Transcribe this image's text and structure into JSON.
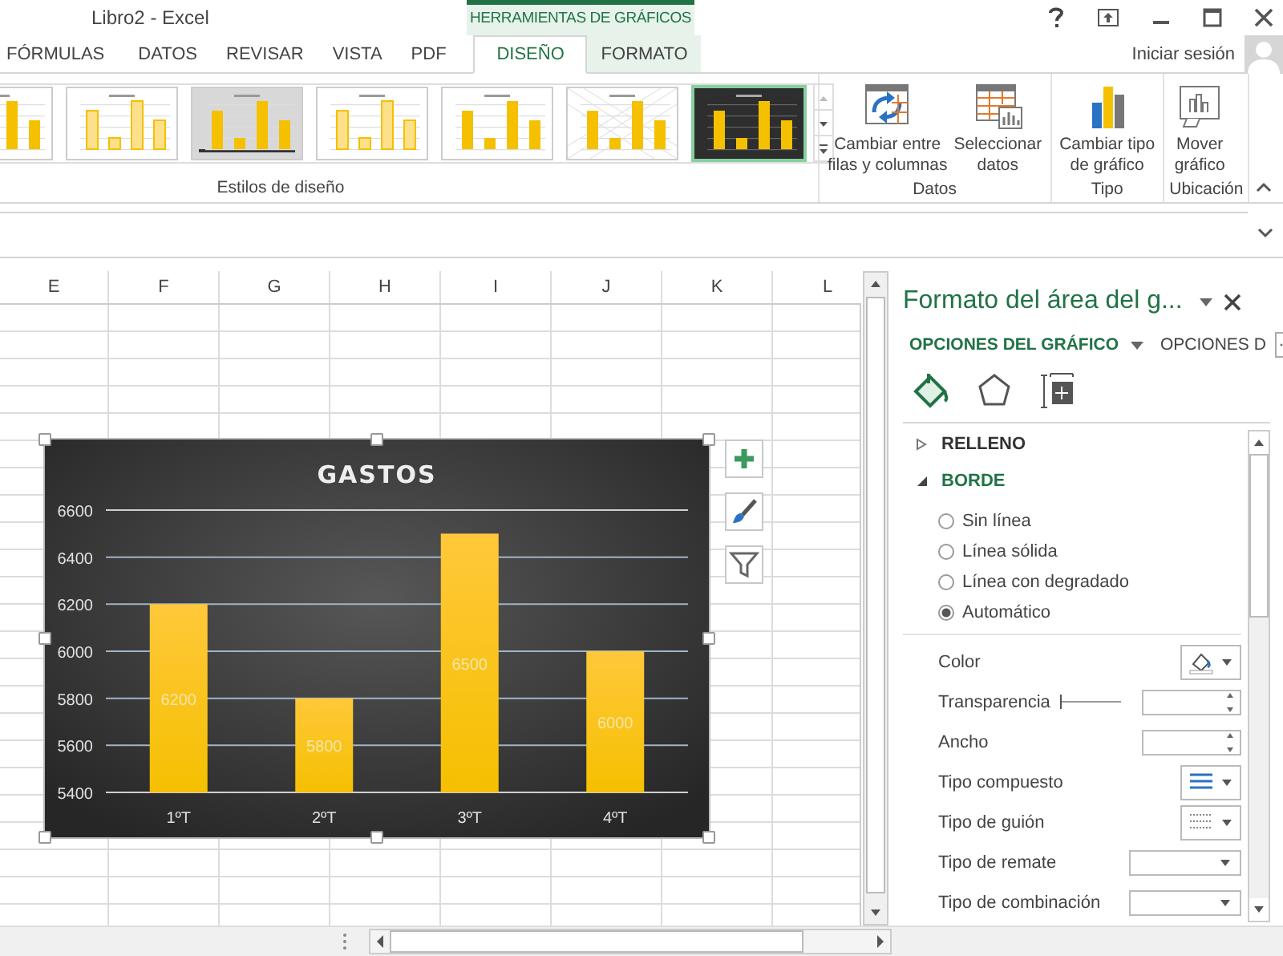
{
  "window": {
    "title": "Libro2 - Excel",
    "context_header": "HERRAMIENTAS DE GRÁFICOS"
  },
  "tabs": [
    {
      "label": "FÓRMULAS",
      "selected": false,
      "contextual": false
    },
    {
      "label": "DATOS",
      "selected": false,
      "contextual": false
    },
    {
      "label": "REVISAR",
      "selected": false,
      "contextual": false
    },
    {
      "label": "VISTA",
      "selected": false,
      "contextual": false
    },
    {
      "label": "PDF",
      "selected": false,
      "contextual": false
    },
    {
      "label": "DISEÑO",
      "selected": true,
      "contextual": true
    },
    {
      "label": "FORMATO",
      "selected": false,
      "contextual": true
    }
  ],
  "account": {
    "label": "Iniciar sesión"
  },
  "ribbon": {
    "chart_styles": [
      {
        "kind": "white",
        "selected": false
      },
      {
        "kind": "striped",
        "selected": false
      },
      {
        "kind": "gray",
        "selected": false
      },
      {
        "kind": "outline",
        "selected": false
      },
      {
        "kind": "plain",
        "selected": false
      },
      {
        "kind": "hatched",
        "selected": false
      },
      {
        "kind": "dark",
        "selected": true
      }
    ],
    "styles_group_label": "Estilos de diseño",
    "groups": [
      {
        "label": "Datos",
        "buttons": [
          {
            "kind": "switch",
            "label": "Cambiar entre\nfilas y columnas"
          },
          {
            "kind": "select",
            "label": "Seleccionar\ndatos"
          }
        ]
      },
      {
        "label": "Tipo",
        "buttons": [
          {
            "kind": "type",
            "label": "Cambiar tipo\nde gráfico"
          }
        ]
      },
      {
        "label": "Ubicación",
        "buttons": [
          {
            "kind": "move",
            "label": "Mover\ngráfico"
          }
        ]
      }
    ]
  },
  "sheet": {
    "columns": [
      "E",
      "F",
      "G",
      "H",
      "I",
      "J",
      "K",
      "L"
    ]
  },
  "chart": {
    "chart_data": {
      "type": "bar",
      "title": "GASTOS",
      "categories": [
        "1ºT",
        "2ºT",
        "3ºT",
        "4ºT"
      ],
      "series": [
        {
          "color": "#f5c000",
          "values": [
            6200,
            5800,
            6500,
            6000
          ]
        }
      ],
      "grid": true,
      "ylim": [
        5400,
        6600
      ],
      "yticks": [
        5400,
        5600,
        5800,
        6000,
        6200,
        6400,
        6600
      ],
      "data_labels": true
    }
  },
  "pane": {
    "title": "Formato del área del g...",
    "tabs": [
      {
        "label": "OPCIONES DEL GRÁFICO",
        "selected": true
      },
      {
        "label": "OPCIONES D",
        "selected": false
      }
    ],
    "icons": [
      {
        "kind": "fill"
      },
      {
        "kind": "effects"
      },
      {
        "kind": "size"
      }
    ],
    "sections": [
      {
        "label": "RELLENO",
        "expanded": false
      },
      {
        "label": "BORDE",
        "expanded": true
      }
    ],
    "line_options": [
      {
        "label": "Sin línea",
        "selected": false
      },
      {
        "label": "Línea sólida",
        "selected": false
      },
      {
        "label": "Línea con degradado",
        "selected": false
      },
      {
        "label": "Automático",
        "selected": true
      }
    ],
    "properties": [
      {
        "kind": "color",
        "label": "Color"
      },
      {
        "kind": "slider",
        "label": "Transparencia",
        "level": 0
      },
      {
        "kind": "spin",
        "label": "Ancho"
      },
      {
        "kind": "compound",
        "label": "Tipo compuesto"
      },
      {
        "kind": "dash",
        "label": "Tipo de guión"
      },
      {
        "kind": "dropdown",
        "label": "Tipo de remate"
      },
      {
        "kind": "dropdown",
        "label": "Tipo de combinación"
      }
    ]
  }
}
